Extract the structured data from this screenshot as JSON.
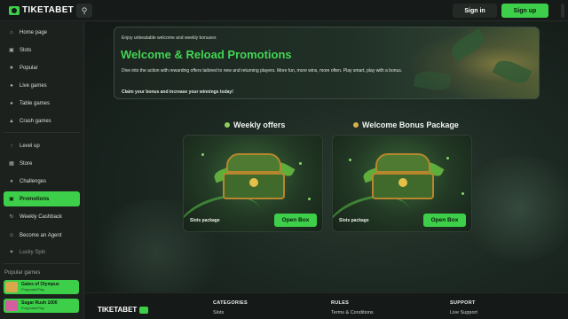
{
  "header": {
    "logo": "TIKETABET",
    "signin_label": "Sign in",
    "signup_label": "Sign up",
    "accent": "#3ecf4a"
  },
  "sidebar": {
    "items": [
      {
        "label": "Home page",
        "icon": "home-icon"
      },
      {
        "label": "Slots",
        "icon": "slots-icon"
      },
      {
        "label": "Popular",
        "icon": "star-icon"
      },
      {
        "label": "Live games",
        "icon": "live-icon"
      },
      {
        "label": "Table games",
        "icon": "cards-icon"
      },
      {
        "label": "Crash games",
        "icon": "rocket-icon"
      },
      {
        "label": "Level up",
        "icon": "level-icon"
      },
      {
        "label": "Store",
        "icon": "store-icon"
      },
      {
        "label": "Challenges",
        "icon": "trophy-icon"
      },
      {
        "label": "Promotions",
        "icon": "gift-icon"
      },
      {
        "label": "Weekly Cashback",
        "icon": "cashback-icon"
      },
      {
        "label": "Become an Agent",
        "icon": "agent-icon"
      },
      {
        "label": "Lucky Spin",
        "icon": "spin-icon"
      }
    ],
    "popular_title": "Popular games",
    "popular_games": [
      {
        "name": "Gates of Olympus",
        "provider": "PragmaticPlay"
      },
      {
        "name": "Sugar Rush 1000",
        "provider": "PragmaticPlay"
      }
    ]
  },
  "banner": {
    "kicker": "Enjoy unbeatable welcome and weekly bonuses",
    "title": "Welcome & Reload Promotions",
    "description": "Dive into the action with rewarding offers tailored to new and returning players. More fun, more wins, more often. Play smart, play with a bonus.",
    "cta": "Claim your bonus and increase your winnings today!"
  },
  "offers": [
    {
      "title": "Weekly offers",
      "label": "Slots package",
      "button": "Open Box"
    },
    {
      "title": "Welcome Bonus Package",
      "label": "Slots package",
      "button": "Open Box"
    }
  ],
  "footer": {
    "logo": "TIKETABET",
    "columns": [
      {
        "heading": "CATEGORIES",
        "first_link": "Slots"
      },
      {
        "heading": "RULES",
        "first_link": "Terms & Conditions"
      },
      {
        "heading": "SUPPORT",
        "first_link": "Live Support"
      }
    ]
  }
}
